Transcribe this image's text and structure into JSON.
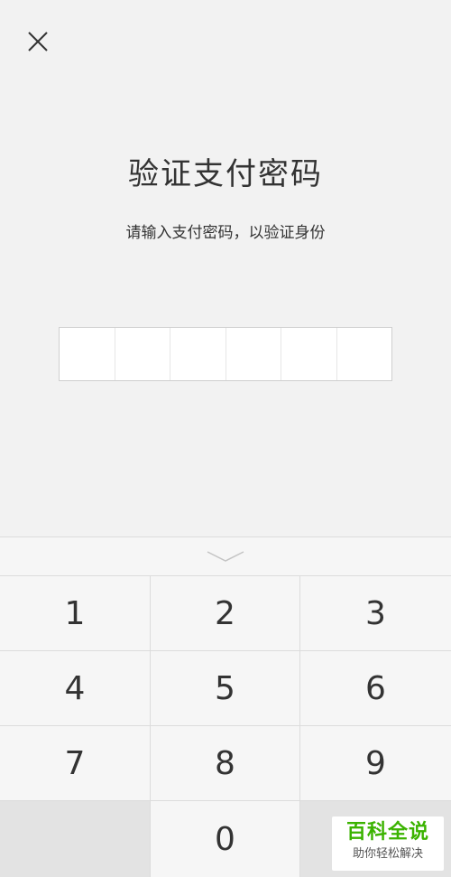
{
  "header": {
    "close_icon": "close-icon"
  },
  "main": {
    "title": "验证支付密码",
    "subtitle": "请输入支付密码，以验证身份",
    "pin_length": 6
  },
  "keypad": {
    "collapse_icon": "chevron-down-icon",
    "keys": [
      "1",
      "2",
      "3",
      "4",
      "5",
      "6",
      "7",
      "8",
      "9",
      "",
      "0",
      ""
    ]
  },
  "watermark": {
    "main": "百科全说",
    "sub": "助你轻松解决"
  },
  "colors": {
    "background": "#f2f2f2",
    "key_dark": "#e3e3e3",
    "watermark_green": "#3bb300"
  }
}
